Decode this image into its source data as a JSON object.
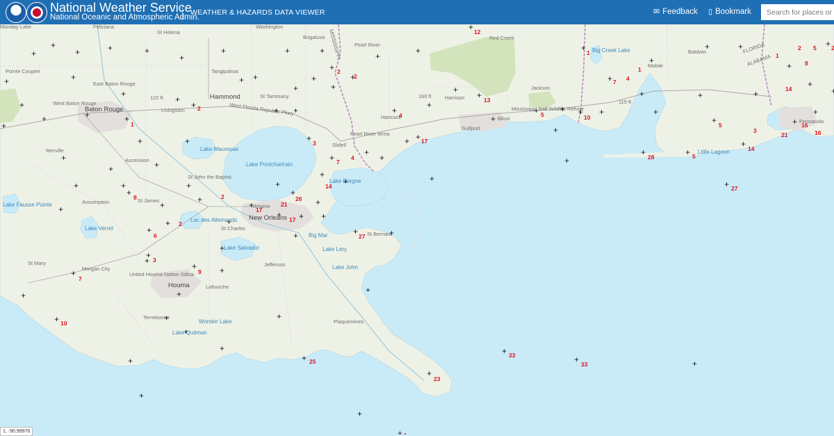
{
  "header": {
    "title": "National Weather Service",
    "subtitle": "National Oceanic and Atmospheric Admin.",
    "app_title": "WEATHER & HAZARDS DATA VIEWER",
    "feedback_label": "Feedback",
    "bookmark_label": "Bookmark",
    "search_placeholder": "Search for places or addresses",
    "logos": [
      "noaa-logo",
      "nws-logo"
    ]
  },
  "map": {
    "coordinate_readout": "1, -90.99976",
    "colors": {
      "water": "#c9ebf8",
      "land": "#eef2e6",
      "forest": "#d3e4bd",
      "wind_label": "#e0101e",
      "header": "#1f6fb4"
    },
    "places": [
      {
        "name": "Baton Rouge",
        "kind": "city"
      },
      {
        "name": "Hammond",
        "kind": "city"
      },
      {
        "name": "Bogalusa",
        "kind": "city"
      },
      {
        "name": "Slidell",
        "kind": "city"
      },
      {
        "name": "Metairie",
        "kind": "city"
      },
      {
        "name": "New Orleans",
        "kind": "city"
      },
      {
        "name": "Gulfport",
        "kind": "city"
      },
      {
        "name": "Biloxi",
        "kind": "city"
      },
      {
        "name": "Mobile",
        "kind": "city"
      },
      {
        "name": "Pensacola",
        "kind": "city"
      },
      {
        "name": "Houma",
        "kind": "city"
      },
      {
        "name": "Morgan City",
        "kind": "city"
      },
      {
        "name": "Plaquemines",
        "kind": "label"
      },
      {
        "name": "St Bernard",
        "kind": "label"
      },
      {
        "name": "Jefferson",
        "kind": "label"
      },
      {
        "name": "Lafourche",
        "kind": "label"
      },
      {
        "name": "Terrebonne",
        "kind": "label"
      },
      {
        "name": "St Charles",
        "kind": "label"
      },
      {
        "name": "St James",
        "kind": "label"
      },
      {
        "name": "Assumption",
        "kind": "label"
      },
      {
        "name": "Ascension",
        "kind": "label"
      },
      {
        "name": "Iberville",
        "kind": "label"
      },
      {
        "name": "Livingston",
        "kind": "label"
      },
      {
        "name": "Tangipahoa",
        "kind": "label"
      },
      {
        "name": "St Tammany",
        "kind": "label"
      },
      {
        "name": "Washington",
        "kind": "label"
      },
      {
        "name": "Pearl River",
        "kind": "label"
      },
      {
        "name": "Hancock",
        "kind": "label"
      },
      {
        "name": "Harrison",
        "kind": "label"
      },
      {
        "name": "Jackson",
        "kind": "label"
      },
      {
        "name": "Baldwin",
        "kind": "label"
      },
      {
        "name": "St Helena",
        "kind": "label"
      },
      {
        "name": "Feliciana",
        "kind": "label"
      },
      {
        "name": "St Mary",
        "kind": "label"
      },
      {
        "name": "East Baton Rouge",
        "kind": "label"
      },
      {
        "name": "West Baton Rouge",
        "kind": "label"
      },
      {
        "name": "Pointe Coupee",
        "kind": "label"
      },
      {
        "name": "St John the Baptist",
        "kind": "label"
      },
      {
        "name": "Lake Pontchartrain",
        "kind": "water"
      },
      {
        "name": "Lake Maurepas",
        "kind": "water"
      },
      {
        "name": "Lake Borgne",
        "kind": "water"
      },
      {
        "name": "Lac des Allemands",
        "kind": "water"
      },
      {
        "name": "Lake Salvador",
        "kind": "water"
      },
      {
        "name": "Lake Verret",
        "kind": "water"
      },
      {
        "name": "Lake Fausse Pointe",
        "kind": "water"
      },
      {
        "name": "Lake Lery",
        "kind": "water"
      },
      {
        "name": "Lake John",
        "kind": "water"
      },
      {
        "name": "Big Mar",
        "kind": "water"
      },
      {
        "name": "Wonder Lake",
        "kind": "water"
      },
      {
        "name": "Lake Quitman",
        "kind": "water"
      },
      {
        "name": "Big Creek Lake",
        "kind": "water"
      },
      {
        "name": "Little Lagoon",
        "kind": "water"
      },
      {
        "name": "United Houma Nation Sdtsa",
        "kind": "label"
      },
      {
        "name": "Mississippi Natl Wildlife Refuge",
        "kind": "label"
      },
      {
        "name": "Pearl River Wma",
        "kind": "label"
      },
      {
        "name": "Red Creek",
        "kind": "label"
      },
      {
        "name": "West Florida Republic Pkwy",
        "kind": "road"
      },
      {
        "name": "122 ft",
        "kind": "label"
      },
      {
        "name": "160 ft",
        "kind": "label"
      },
      {
        "name": "119 ft",
        "kind": "label"
      },
      {
        "name": "FLORIDA",
        "kind": "label"
      },
      {
        "name": "ALABAMA",
        "kind": "label"
      },
      {
        "name": "MISSISSIPPI",
        "kind": "label"
      },
      {
        "name": "Monday Lake",
        "kind": "label"
      }
    ],
    "wind_observations": [
      "1",
      "2",
      "2",
      "2",
      "3",
      "7",
      "4",
      "14",
      "2",
      "26",
      "21",
      "17",
      "17",
      "27",
      "8",
      "2",
      "6",
      "3",
      "7",
      "9",
      "10",
      "25",
      "23",
      "33",
      "33",
      "4",
      "17",
      "12",
      "13",
      "5",
      "10",
      "1",
      "7",
      "4",
      "1",
      "28",
      "5",
      "27",
      "14",
      "3",
      "21",
      "16",
      "16",
      "5",
      "8",
      "14",
      "5",
      "1",
      "2",
      "4",
      "2"
    ]
  }
}
